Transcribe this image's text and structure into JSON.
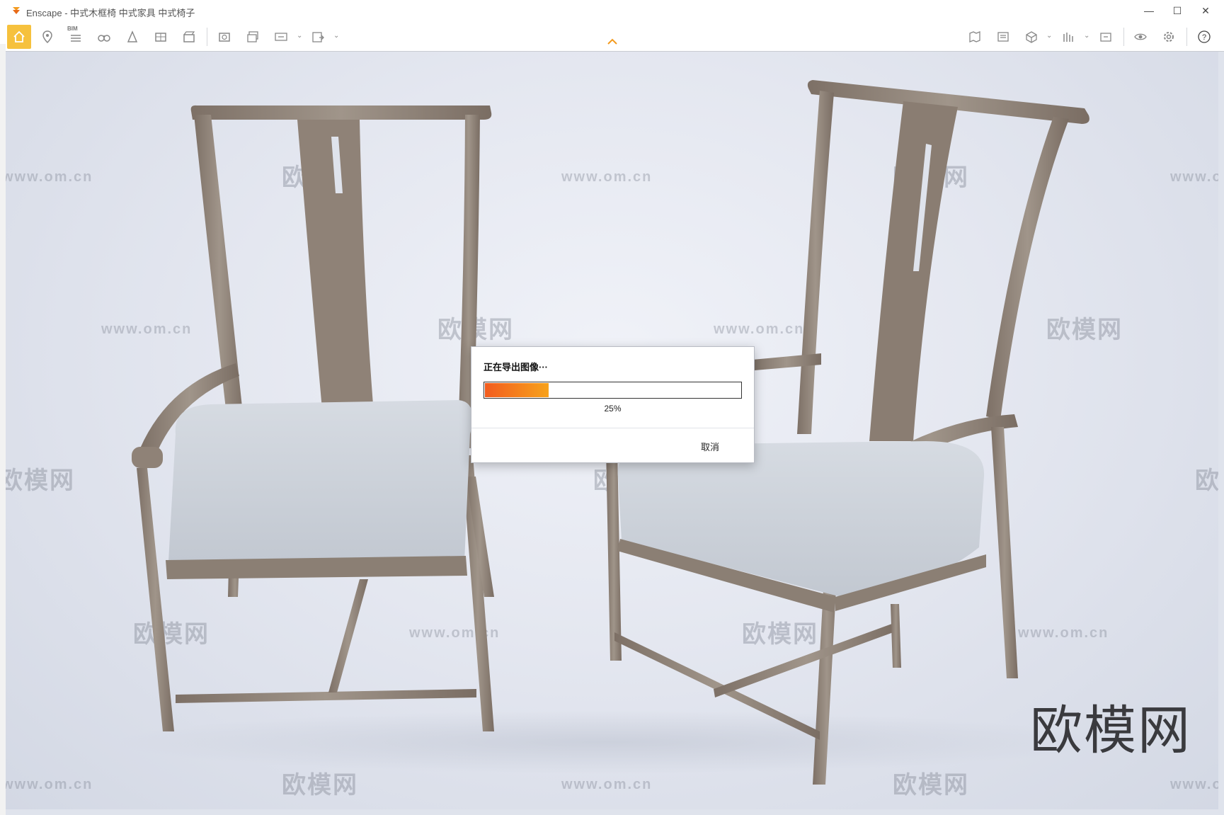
{
  "window": {
    "title": "Enscape - 中式木框椅 中式家具 中式椅子",
    "minimize_glyph": "—",
    "maximize_glyph": "☐",
    "close_glyph": "✕"
  },
  "toolbar": {
    "bim_label": "BIM",
    "left_icons": [
      "home-icon",
      "location-pin-icon",
      "bim-list-icon",
      "binoculars-icon",
      "view-management-icon",
      "panorama-icon",
      "video-editor-icon",
      "screenshot-icon",
      "batch-render-icon",
      "panorama-360-icon",
      "exe-export-icon"
    ],
    "right_icons": [
      "map-icon",
      "material-editor-icon",
      "asset-library-icon",
      "vr-icon",
      "sync-icon",
      "visual-settings-icon",
      "general-settings-icon",
      "help-icon"
    ]
  },
  "watermarks": {
    "logo_text": "欧模网",
    "url_text": "www.om.cn",
    "brand_big": "欧模网"
  },
  "export_dialog": {
    "title": "正在导出图像···",
    "progress_percent": 25,
    "progress_label": "25%",
    "cancel_label": "取消"
  },
  "colors": {
    "accent_home": "#f6c13d",
    "progress_start": "#f25c1e",
    "progress_end": "#f7a21b"
  }
}
